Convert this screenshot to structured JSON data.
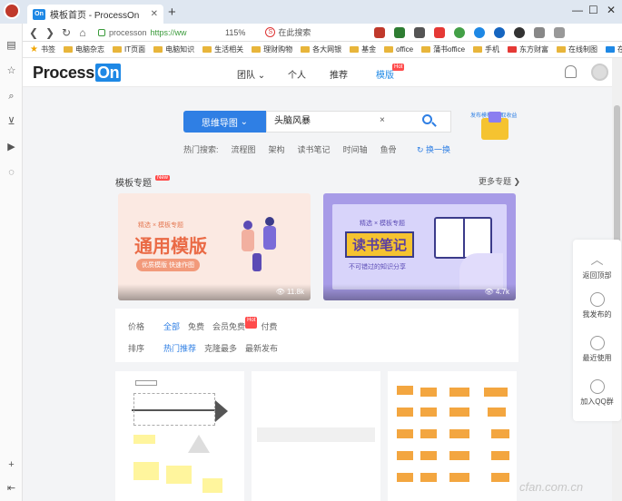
{
  "browser": {
    "tab_title": "模板首页 - ProcessOn",
    "tab_logo": "On",
    "new_tab": "+",
    "url_host": "processon",
    "url_full": "https://ww",
    "zoom": "115%",
    "search_placeholder": "在此搜索",
    "bookmarks_label": "书签",
    "bookmarks": [
      "电脑杂志",
      "IT页面",
      "电脑知识",
      "生活相关",
      "理财购物",
      "各大网银",
      "基金",
      "office",
      "蒲书office",
      "手机",
      "东方财富",
      "在线制图",
      "在线"
    ],
    "nav": {
      "back": "❮",
      "forward": "❯",
      "reload": "↻",
      "home": "⌂"
    },
    "window": {
      "min": "—",
      "max": "☐",
      "close": "✕"
    }
  },
  "site": {
    "brand_main": "Process",
    "brand_on": "On",
    "nav": {
      "team": "团队",
      "personal": "个人",
      "recommend": "推荐",
      "template": "模版",
      "hot": "Hot"
    },
    "search": {
      "type": "思维导图",
      "query": "头脑风暴",
      "clear": "×",
      "hot_label": "热门搜索:",
      "hot_terms": [
        "流程图",
        "架构",
        "读书笔记",
        "时间轴",
        "鱼骨"
      ],
      "refresh": "换一换"
    },
    "promo": {
      "left": "发布模板",
      "right": "赚取收益"
    },
    "section": {
      "title": "模板专题",
      "badge": "New",
      "more": "更多专题"
    },
    "cards": [
      {
        "title": "通用模版",
        "tag": "精选 × 模板专题",
        "sub": "优质模版 快速作图",
        "count": "11.8k"
      },
      {
        "title": "读书笔记",
        "tag": "精选 × 模板专题",
        "sub": "不可错过的知识分享",
        "count": "4.7k"
      }
    ],
    "filter": {
      "price_label": "价格",
      "price_opts": [
        "全部",
        "免费",
        "会员免费",
        "付费"
      ],
      "sort_label": "排序",
      "sort_opts": [
        "热门推荐",
        "克隆最多",
        "最新发布"
      ],
      "hot": "Hot"
    },
    "float": [
      "返回顶部",
      "我发布的",
      "最近使用",
      "加入QQ群"
    ],
    "watermark": "cfan.com.cn"
  },
  "colors": {
    "accent": "#2f7fe4",
    "hot": "#ff4b4b",
    "brand_on": "#1e88e5"
  }
}
